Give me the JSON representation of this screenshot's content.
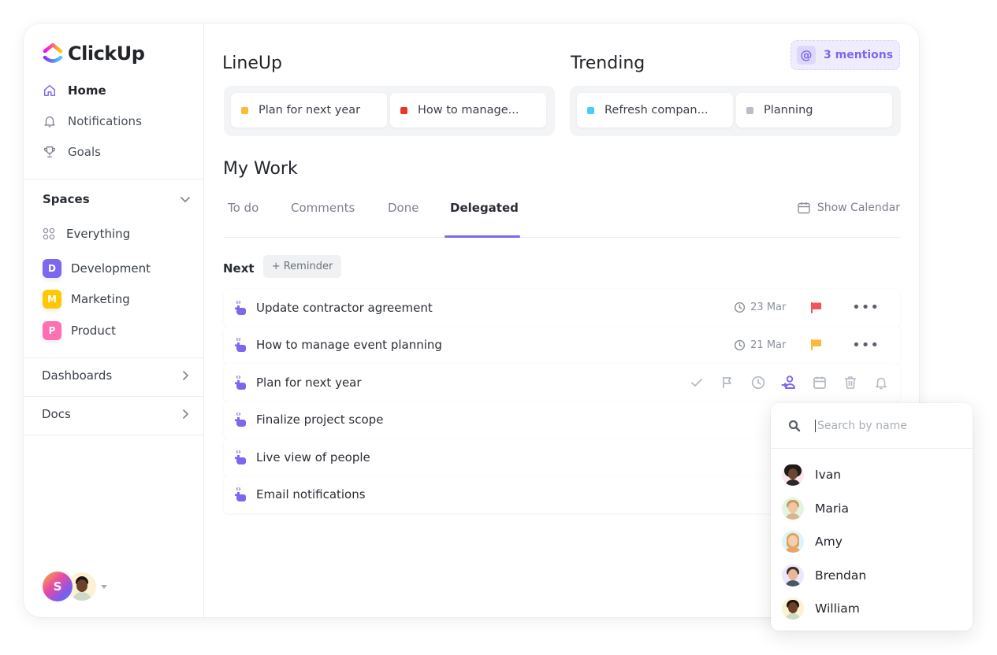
{
  "brand": {
    "name": "ClickUp"
  },
  "sidebar": {
    "nav": [
      {
        "label": "Home",
        "icon": "home-icon",
        "active": true
      },
      {
        "label": "Notifications",
        "icon": "bell-icon",
        "active": false
      },
      {
        "label": "Goals",
        "icon": "trophy-icon",
        "active": false
      }
    ],
    "spaces_label": "Spaces",
    "everything_label": "Everything",
    "spaces": [
      {
        "letter": "D",
        "label": "Development",
        "color": "#7b68ee"
      },
      {
        "letter": "M",
        "label": "Marketing",
        "color": "#ffc800"
      },
      {
        "letter": "P",
        "label": "Product",
        "color": "#ff6fb1"
      }
    ],
    "sections": [
      {
        "label": "Dashboards"
      },
      {
        "label": "Docs"
      }
    ],
    "user": {
      "initial": "S"
    }
  },
  "lineup": {
    "title": "LineUp",
    "items": [
      {
        "label": "Plan for next year",
        "color": "#ffb938"
      },
      {
        "label": "How to manage...",
        "color": "#e6392b"
      }
    ]
  },
  "trending": {
    "title": "Trending",
    "items": [
      {
        "label": "Refresh compan...",
        "color": "#49ccf9"
      },
      {
        "label": "Planning",
        "color": "#b9bec7"
      }
    ]
  },
  "mentions": {
    "label": "3 mentions",
    "icon": "@"
  },
  "my_work": {
    "title": "My Work",
    "tabs": [
      {
        "label": "To do",
        "active": false
      },
      {
        "label": "Comments",
        "active": false
      },
      {
        "label": "Done",
        "active": false
      },
      {
        "label": "Delegated",
        "active": true
      }
    ],
    "show_calendar": "Show Calendar",
    "next_label": "Next",
    "reminder_label": "+ Reminder",
    "tasks": [
      {
        "title": "Update contractor agreement",
        "due": "23 Mar",
        "flag_color": "#f2545b"
      },
      {
        "title": "How to manage event planning",
        "due": "21 Mar",
        "flag_color": "#ffb938"
      },
      {
        "title": "Plan for next year",
        "hovered": true
      },
      {
        "title": "Finalize project scope"
      },
      {
        "title": "Live view of people"
      },
      {
        "title": "Email notifications"
      }
    ],
    "hover_actions": [
      "check-icon",
      "flag-icon",
      "clock-icon",
      "assign-user-icon",
      "calendar-icon",
      "trash-icon",
      "bell-icon"
    ]
  },
  "assign_popup": {
    "search_placeholder": "Search by name",
    "search_value": "",
    "people": [
      {
        "name": "Ivan",
        "bg": "#fde4ef",
        "skin": "#6b4530",
        "hair": "#1e1a18",
        "shirt": "#2a2a2a"
      },
      {
        "name": "Maria",
        "bg": "#e3f5e1",
        "skin": "#f0c7a3",
        "hair": "#c99a5b",
        "shirt": "#d8b58c"
      },
      {
        "name": "Amy",
        "bg": "#dff3fb",
        "skin": "#f4cfae",
        "hair": "#e0a35a",
        "shirt": "#e8a36b"
      },
      {
        "name": "Brendan",
        "bg": "#ebe8fb",
        "skin": "#e8b896",
        "hair": "#3a2f2a",
        "shirt": "#4a5664"
      },
      {
        "name": "William",
        "bg": "#fdf1d3",
        "skin": "#6b4228",
        "hair": "#1a1412",
        "shirt": "#cfd9c8"
      }
    ]
  },
  "colors": {
    "accent": "#7b68ee",
    "text_primary": "#2a2e34",
    "text_muted": "#7c828d"
  }
}
